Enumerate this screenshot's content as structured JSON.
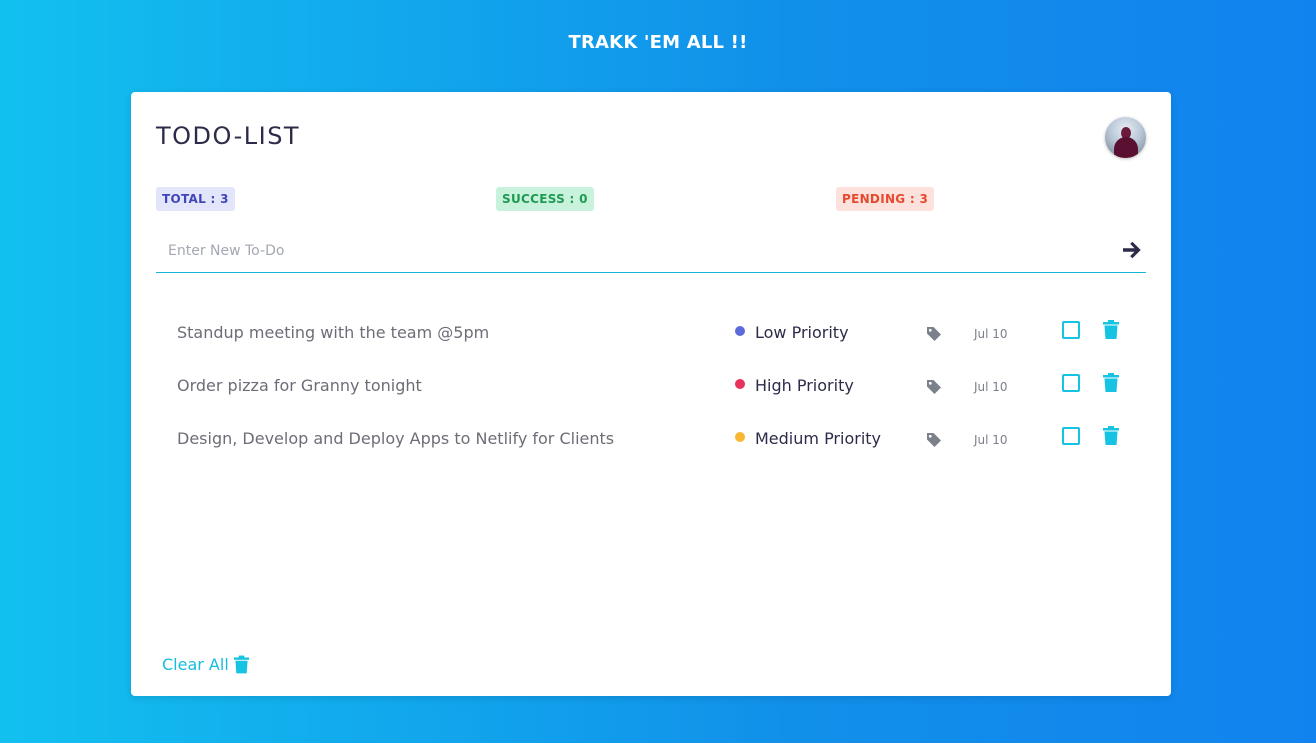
{
  "app": {
    "title": "TRAKK 'EM ALL !!"
  },
  "card": {
    "title": "TODO-LIST",
    "avatar_icon": "user-avatar"
  },
  "stats": {
    "total": "TOTAL : 3",
    "success": "SUCCESS : 0",
    "pending": "PENDING : 3"
  },
  "input": {
    "placeholder": "Enter New To-Do",
    "value": "",
    "submit_icon": "arrow-right-icon"
  },
  "todos": [
    {
      "text": "Standup meeting with the team @5pm",
      "priority": "Low Priority",
      "priority_color": "#5c6bdc",
      "date": "Jul 10",
      "done": false
    },
    {
      "text": "Order pizza for Granny tonight",
      "priority": "High Priority",
      "priority_color": "#e7335b",
      "date": "Jul 10",
      "done": false
    },
    {
      "text": "Design, Develop and Deploy Apps to Netlify for Clients",
      "priority": "Medium Priority",
      "priority_color": "#f7b731",
      "date": "Jul 10",
      "done": false
    }
  ],
  "footer": {
    "clear_all": "Clear All"
  },
  "colors": {
    "accent": "#16c3e2",
    "title_text": "#2c2c4a",
    "icon_gray": "#7c808a"
  }
}
